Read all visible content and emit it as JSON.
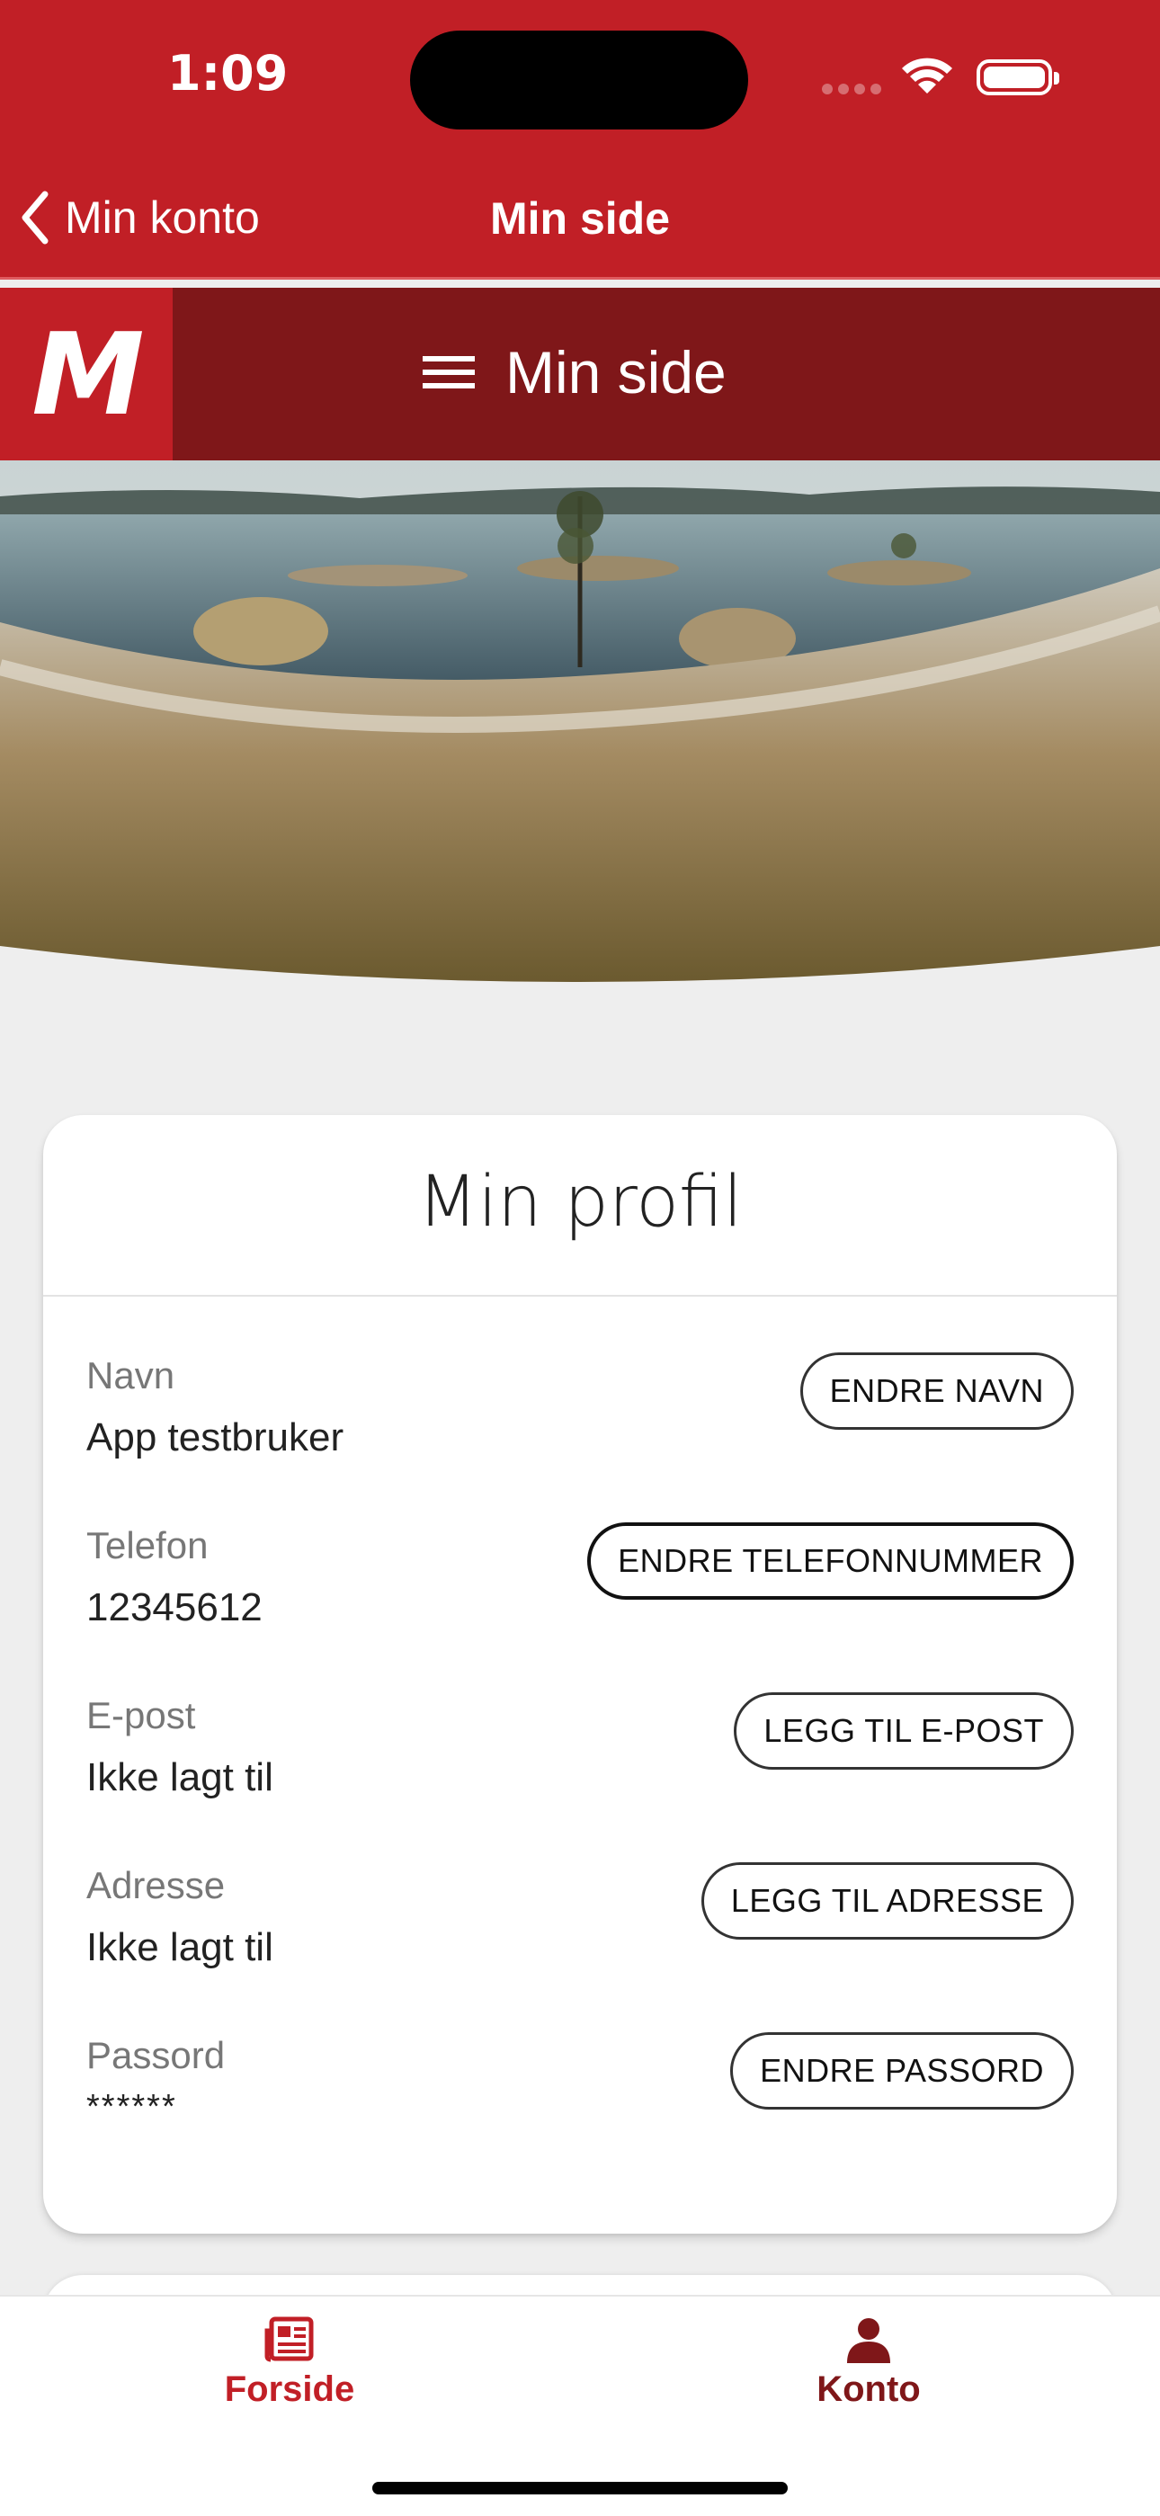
{
  "status": {
    "time": "1:09"
  },
  "nav": {
    "back_label": "Min konto",
    "title": "Min side"
  },
  "header": {
    "logo_text": "M",
    "menu_label": "Min side"
  },
  "profile": {
    "title": "Min profil",
    "rows": [
      {
        "label": "Navn",
        "value": "App testbruker",
        "button": "ENDRE NAVN"
      },
      {
        "label": "Telefon",
        "value": "12345612",
        "button": "ENDRE TELEFONNUMMER"
      },
      {
        "label": "E-post",
        "value": "Ikke lagt til",
        "button": "LEGG TIL E-POST"
      },
      {
        "label": "Adresse",
        "value": "Ikke lagt til",
        "button": "LEGG TIL ADRESSE"
      },
      {
        "label": "Passord",
        "value": "******",
        "button": "ENDRE PASSORD"
      }
    ]
  },
  "tabbar": {
    "items": [
      {
        "label": "Forside",
        "icon": "newspaper-icon"
      },
      {
        "label": "Konto",
        "icon": "person-icon"
      }
    ]
  },
  "colors": {
    "brand_red": "#c11f26",
    "dark_red": "#7f1719",
    "background": "#eeeeee"
  }
}
